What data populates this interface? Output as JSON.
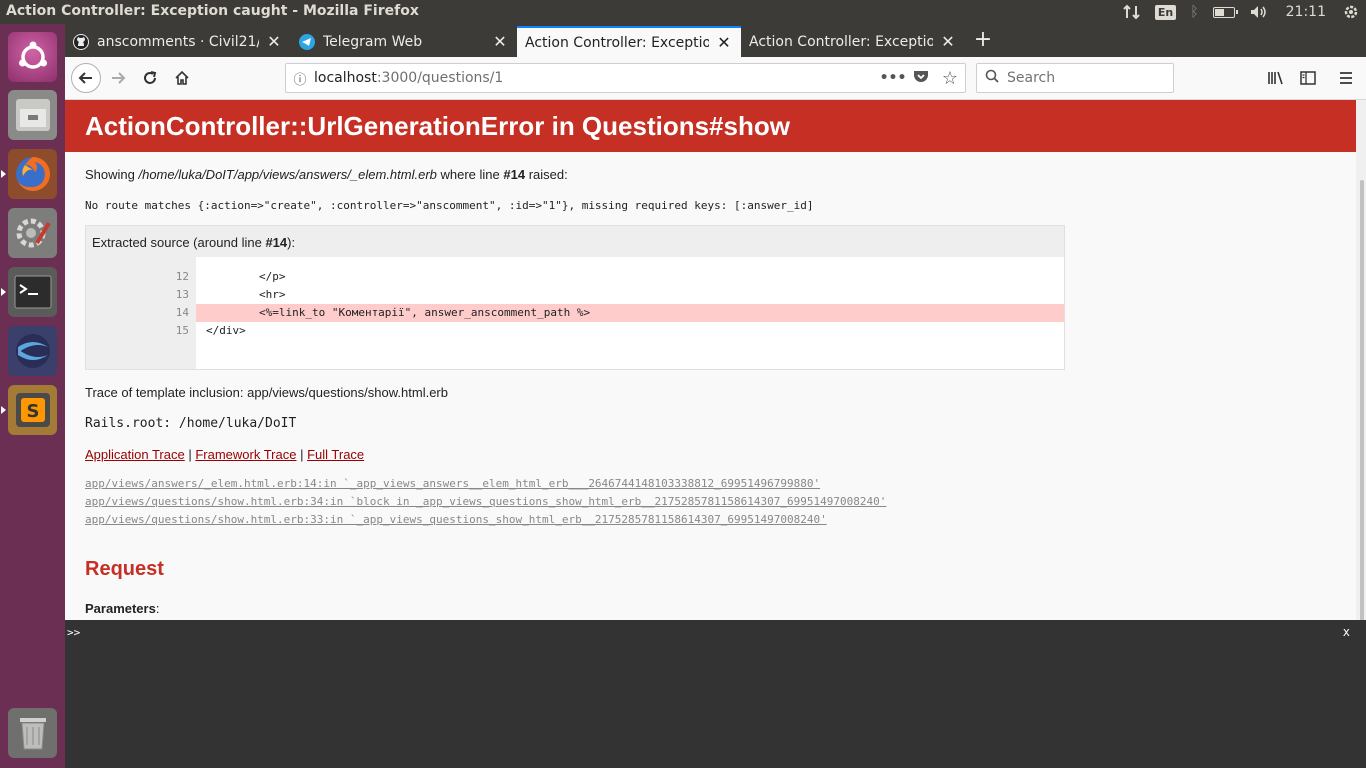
{
  "top_panel": {
    "window_title": "Action Controller: Exception caught - Mozilla Firefox",
    "keyboard_layout": "En",
    "clock": "21:11"
  },
  "launcher": {
    "items": [
      "ubuntu-dash",
      "files",
      "firefox",
      "system-settings",
      "terminal",
      "app-icon",
      "sublime-text",
      "trash"
    ]
  },
  "tabs": [
    {
      "label": "anscomments · Civil21/D",
      "icon": "github-icon",
      "active": false
    },
    {
      "label": "Telegram Web",
      "icon": "telegram-icon",
      "active": false
    },
    {
      "label": "Action Controller: Exceptio",
      "icon": "",
      "active": true
    },
    {
      "label": "Action Controller: Exceptio",
      "icon": "",
      "active": false
    }
  ],
  "navbar": {
    "url_host": "localhost",
    "url_rest": ":3000/questions/1",
    "search_placeholder": "Search"
  },
  "page": {
    "error_title": "ActionController::UrlGenerationError in Questions#show",
    "showing_prefix": "Showing ",
    "showing_path": "/home/luka/DoIT/app/views/answers/_elem.html.erb",
    "showing_mid": " where line ",
    "showing_line": "#14",
    "showing_suffix": " raised:",
    "message": "No route matches {:action=>\"create\", :controller=>\"anscomment\", :id=>\"1\"}, missing required keys: [:answer_id]",
    "source_head_prefix": "Extracted source (around line ",
    "source_head_line": "#14",
    "source_head_suffix": "):",
    "source_lines": [
      {
        "num": "12",
        "code": "        </p>",
        "highlight": false
      },
      {
        "num": "13",
        "code": "        <hr>",
        "highlight": false
      },
      {
        "num": "14",
        "code": "        <%=link_to \"Коментарії\", answer_anscomment_path %>",
        "highlight": true
      },
      {
        "num": "15",
        "code": "</div>",
        "highlight": false
      }
    ],
    "template_trace": "Trace of template inclusion: app/views/questions/show.html.erb",
    "rails_root": "Rails.root: /home/luka/DoIT",
    "trace_links": {
      "application": "Application Trace",
      "framework": "Framework Trace",
      "full": "Full Trace",
      "separator": " | "
    },
    "trace_lines": [
      "app/views/answers/_elem.html.erb:14:in `_app_views_answers__elem_html_erb___2646744148103338812_69951496799880'",
      "app/views/questions/show.html.erb:34:in `block in _app_views_questions_show_html_erb__2175285781158614307_69951497008240'",
      "app/views/questions/show.html.erb:33:in `_app_views_questions_show_html_erb__2175285781158614307_69951497008240'"
    ],
    "request_title": "Request",
    "parameters_label": "Parameters",
    "parameters_colon": ":"
  },
  "console": {
    "prompt": ">>",
    "close": "x"
  },
  "colors": {
    "error_red": "#c52f24",
    "launcher_bg": "#6a2f52",
    "panel_bg": "#3c3b37"
  }
}
